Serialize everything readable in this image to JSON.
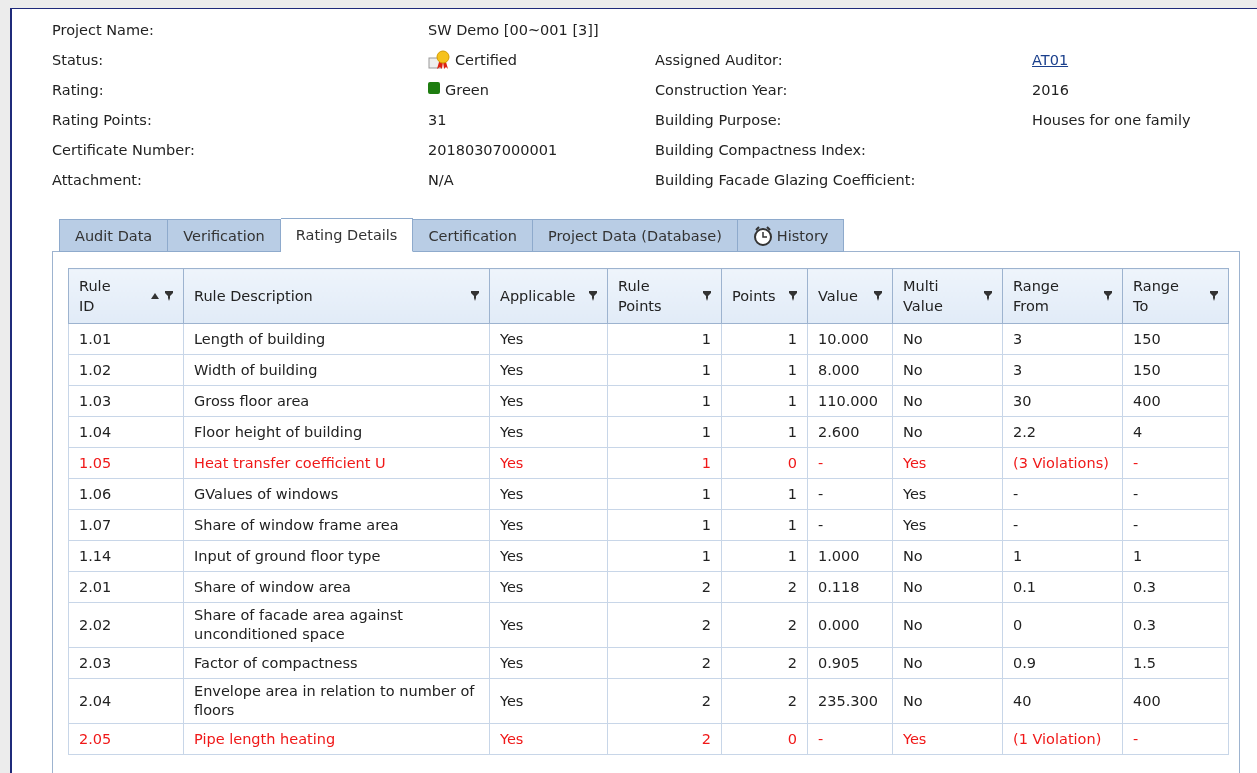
{
  "details": {
    "left": [
      {
        "label": "Project Name:",
        "value": "SW Demo [00~001 [3]]",
        "kind": "text"
      },
      {
        "label": "Status:",
        "value": "Certified",
        "kind": "status"
      },
      {
        "label": "Rating:",
        "value": "Green",
        "kind": "rating",
        "color": "#1e7d10"
      },
      {
        "label": "Rating Points:",
        "value": "31",
        "kind": "text"
      },
      {
        "label": "Certificate Number:",
        "value": "20180307000001",
        "kind": "text"
      },
      {
        "label": "Attachment:",
        "value": "N/A",
        "kind": "text"
      }
    ],
    "right": [
      {
        "label": "Assigned Auditor:",
        "value": "AT01",
        "kind": "link"
      },
      {
        "label": "Construction Year:",
        "value": "2016",
        "kind": "text"
      },
      {
        "label": "Building Purpose:",
        "value": "Houses for one family",
        "kind": "text"
      },
      {
        "label": "Building Compactness Index:",
        "kind": "text"
      },
      {
        "label": "Building Facade Glazing Coefficient:",
        "kind": "text"
      }
    ]
  },
  "tabs": [
    {
      "label": "Audit Data",
      "selected": false
    },
    {
      "label": "Verification",
      "selected": false
    },
    {
      "label": "Rating Details",
      "selected": true
    },
    {
      "label": "Certification",
      "selected": false
    },
    {
      "label": "Project Data (Database)",
      "selected": false
    },
    {
      "label": "History",
      "selected": false,
      "kind": "history"
    }
  ],
  "table": {
    "columns": [
      {
        "label": "Rule ID",
        "sorted": true,
        "kind": "text"
      },
      {
        "label": "Rule Description",
        "kind": "text"
      },
      {
        "label": "Applicable",
        "kind": "text"
      },
      {
        "label": "Rule Points",
        "kind": "number"
      },
      {
        "label": "Points",
        "kind": "number"
      },
      {
        "label": "Value",
        "kind": "text"
      },
      {
        "label": "Multi Value",
        "kind": "text"
      },
      {
        "label": "Range From",
        "kind": "text"
      },
      {
        "label": "Range To",
        "kind": "text"
      }
    ],
    "rows": [
      {
        "violation": false,
        "cells": [
          "1.01",
          "Length of building",
          "Yes",
          "1",
          "1",
          "10.000",
          "No",
          "3",
          "150"
        ]
      },
      {
        "violation": false,
        "cells": [
          "1.02",
          "Width of building",
          "Yes",
          "1",
          "1",
          "8.000",
          "No",
          "3",
          "150"
        ]
      },
      {
        "violation": false,
        "cells": [
          "1.03",
          "Gross floor area",
          "Yes",
          "1",
          "1",
          "110.000",
          "No",
          "30",
          "400"
        ]
      },
      {
        "violation": false,
        "cells": [
          "1.04",
          "Floor height of building",
          "Yes",
          "1",
          "1",
          "2.600",
          "No",
          "2.2",
          "4"
        ]
      },
      {
        "violation": true,
        "cells": [
          "1.05",
          "Heat transfer coefficient U",
          "Yes",
          "1",
          "0",
          "-",
          "Yes",
          "(3 Violations)",
          "-"
        ]
      },
      {
        "violation": false,
        "cells": [
          "1.06",
          "GValues of windows",
          "Yes",
          "1",
          "1",
          "-",
          "Yes",
          "-",
          "-"
        ]
      },
      {
        "violation": false,
        "cells": [
          "1.07",
          "Share of window frame area",
          "Yes",
          "1",
          "1",
          "-",
          "Yes",
          "-",
          "-"
        ]
      },
      {
        "violation": false,
        "cells": [
          "1.14",
          "Input of ground floor type",
          "Yes",
          "1",
          "1",
          "1.000",
          "No",
          "1",
          "1"
        ]
      },
      {
        "violation": false,
        "cells": [
          "2.01",
          "Share of window area",
          "Yes",
          "2",
          "2",
          "0.118",
          "No",
          "0.1",
          "0.3"
        ]
      },
      {
        "violation": false,
        "cells": [
          "2.02",
          "Share of facade area against unconditioned space",
          "Yes",
          "2",
          "2",
          "0.000",
          "No",
          "0",
          "0.3"
        ]
      },
      {
        "violation": false,
        "cells": [
          "2.03",
          "Factor of compactness",
          "Yes",
          "2",
          "2",
          "0.905",
          "No",
          "0.9",
          "1.5"
        ]
      },
      {
        "violation": false,
        "cells": [
          "2.04",
          "Envelope area in relation to number of floors",
          "Yes",
          "2",
          "2",
          "235.300",
          "No",
          "40",
          "400"
        ]
      },
      {
        "violation": true,
        "cells": [
          "2.05",
          "Pipe length heating",
          "Yes",
          "2",
          "0",
          "-",
          "Yes",
          "(1 Violation)",
          "-"
        ]
      }
    ]
  }
}
